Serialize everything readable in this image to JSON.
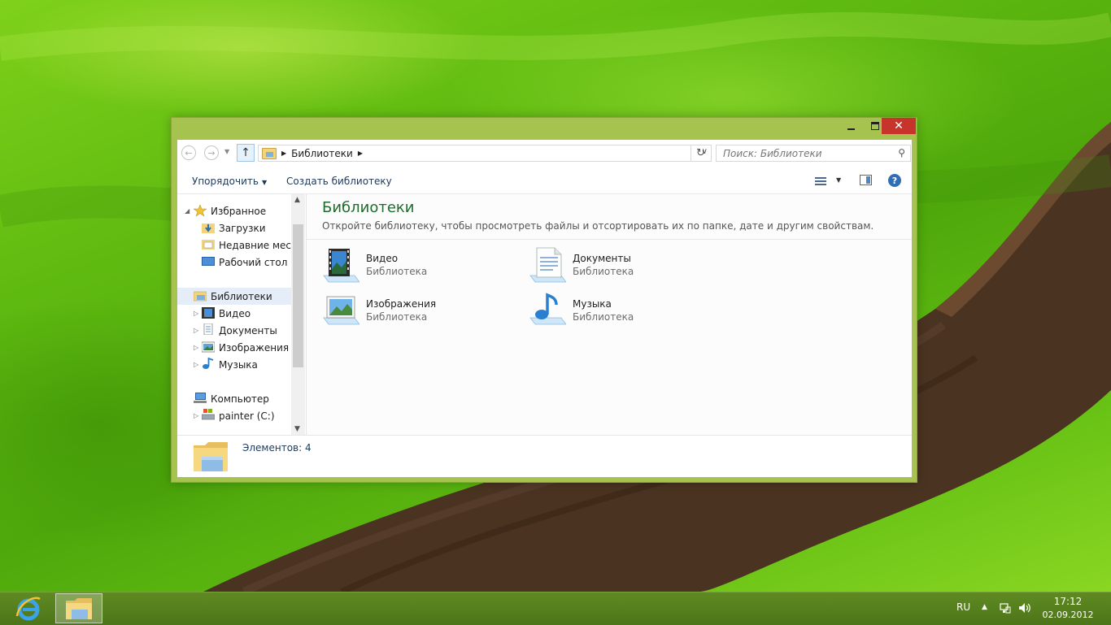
{
  "window": {
    "controls": {
      "minimize": "minimize",
      "maximize": "maximize",
      "close": "✕"
    }
  },
  "address_bar": {
    "breadcrumb": "Библиотеки",
    "search_placeholder": "Поиск: Библиотеки"
  },
  "commands": {
    "organize": "Упорядочить",
    "create_library": "Создать библиотеку"
  },
  "nav_pane": {
    "favorites": {
      "label": "Избранное",
      "items": [
        "Загрузки",
        "Недавние места",
        "Рабочий стол"
      ]
    },
    "libraries": {
      "label": "Библиотеки",
      "items": [
        "Видео",
        "Документы",
        "Изображения",
        "Музыка"
      ]
    },
    "computer": {
      "label": "Компьютер",
      "items": [
        "painter (C:)"
      ]
    }
  },
  "content": {
    "title": "Библиотеки",
    "description": "Откройте библиотеку, чтобы просмотреть файлы и отсортировать их по папке, дате и другим свойствам.",
    "libraries": [
      {
        "name": "Видео",
        "type": "Библиотека",
        "icon": "video-library-icon"
      },
      {
        "name": "Документы",
        "type": "Библиотека",
        "icon": "documents-library-icon"
      },
      {
        "name": "Изображения",
        "type": "Библиотека",
        "icon": "pictures-library-icon"
      },
      {
        "name": "Музыка",
        "type": "Библиотека",
        "icon": "music-library-icon"
      }
    ]
  },
  "details": {
    "item_count": "Элементов: 4"
  },
  "taskbar": {
    "language": "RU",
    "time": "17:12",
    "date": "02.09.2012"
  },
  "colors": {
    "window_frame": "#a7c34f",
    "close_button": "#c7342c",
    "title_green": "#1e6d2c",
    "taskbar": "#5f8a22"
  }
}
